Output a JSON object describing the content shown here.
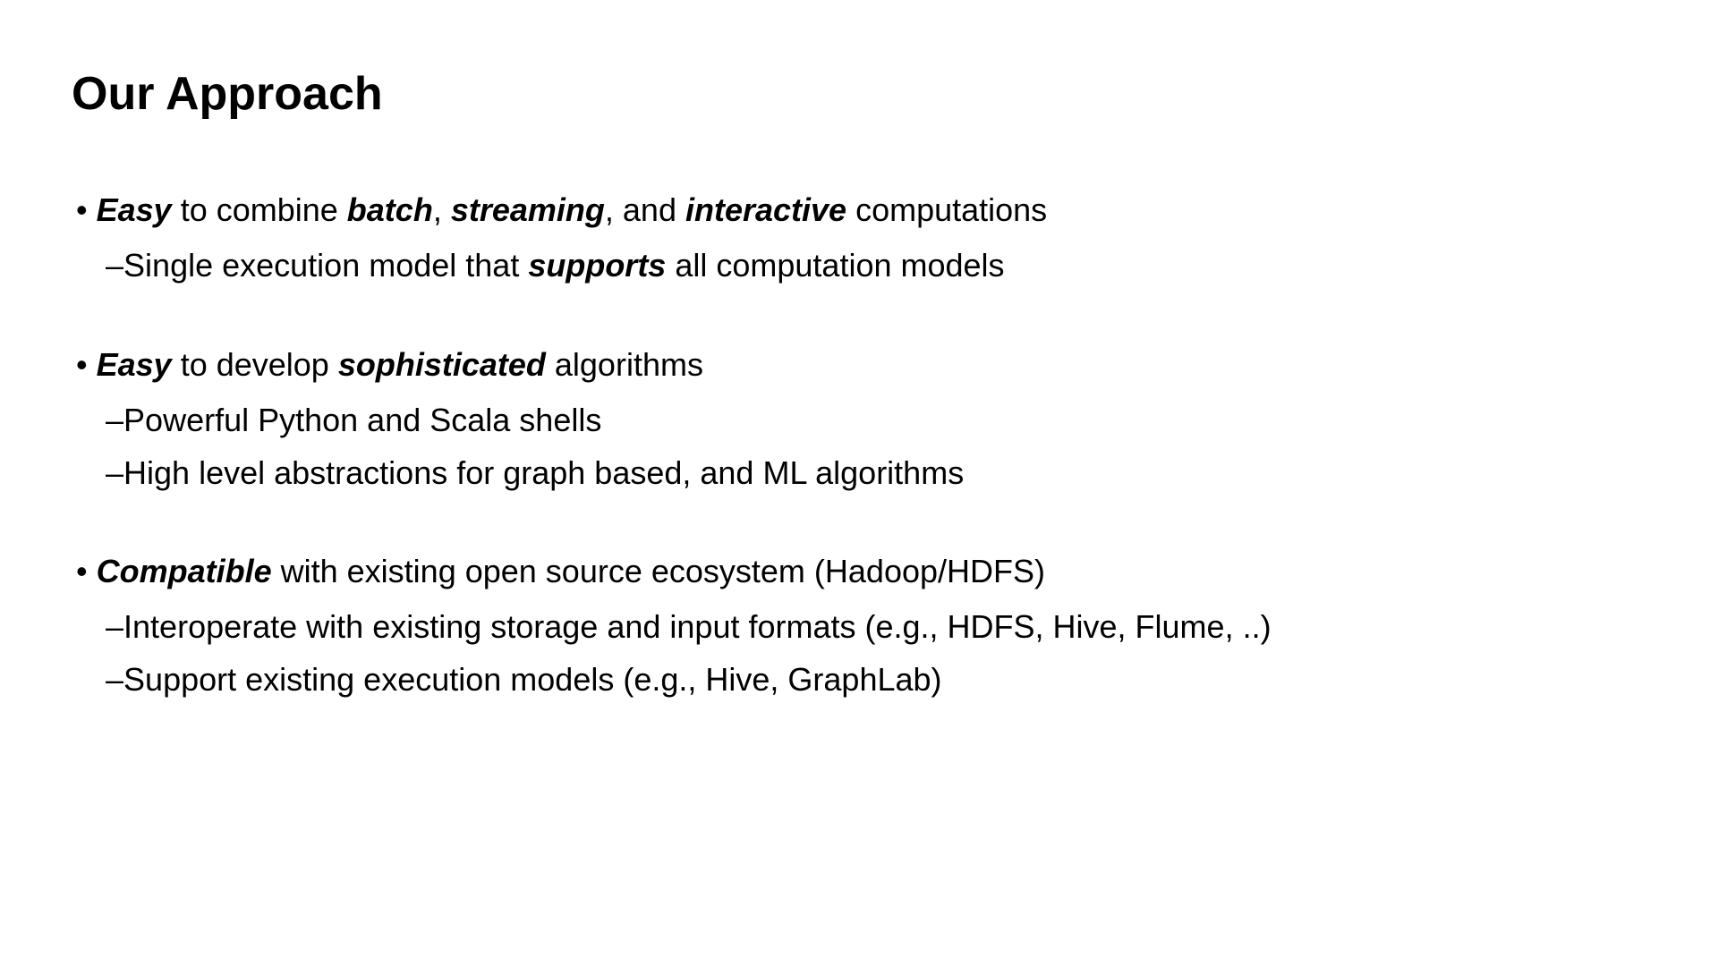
{
  "title": "Our Approach",
  "sections": [
    {
      "main_parts": [
        "Easy",
        " to combine ",
        "batch",
        ", ",
        "streaming",
        ", and ",
        "interactive",
        " computations"
      ],
      "main_emph": [
        true,
        false,
        true,
        false,
        true,
        false,
        true,
        false
      ],
      "subs": [
        {
          "parts": [
            "Single execution model that ",
            "supports",
            " all computation models"
          ],
          "emph": [
            false,
            true,
            false
          ]
        }
      ]
    },
    {
      "main_parts": [
        "Easy",
        " to develop ",
        "sophisticated",
        " algorithms"
      ],
      "main_emph": [
        true,
        false,
        true,
        false
      ],
      "subs": [
        {
          "parts": [
            "Powerful Python and Scala shells"
          ],
          "emph": [
            false
          ]
        },
        {
          "parts": [
            "High level abstractions for graph based, and ML algorithms"
          ],
          "emph": [
            false
          ]
        }
      ]
    },
    {
      "main_parts": [
        "Compatible",
        " with existing open source ecosystem (Hadoop/HDFS)"
      ],
      "main_emph": [
        true,
        false
      ],
      "subs": [
        {
          "parts": [
            "Interoperate with existing storage and input formats (e.g., HDFS, Hive, Flume, ..)"
          ],
          "emph": [
            false
          ]
        },
        {
          "parts": [
            "Support existing execution models (e.g., Hive, GraphLab)"
          ],
          "emph": [
            false
          ]
        }
      ]
    }
  ]
}
